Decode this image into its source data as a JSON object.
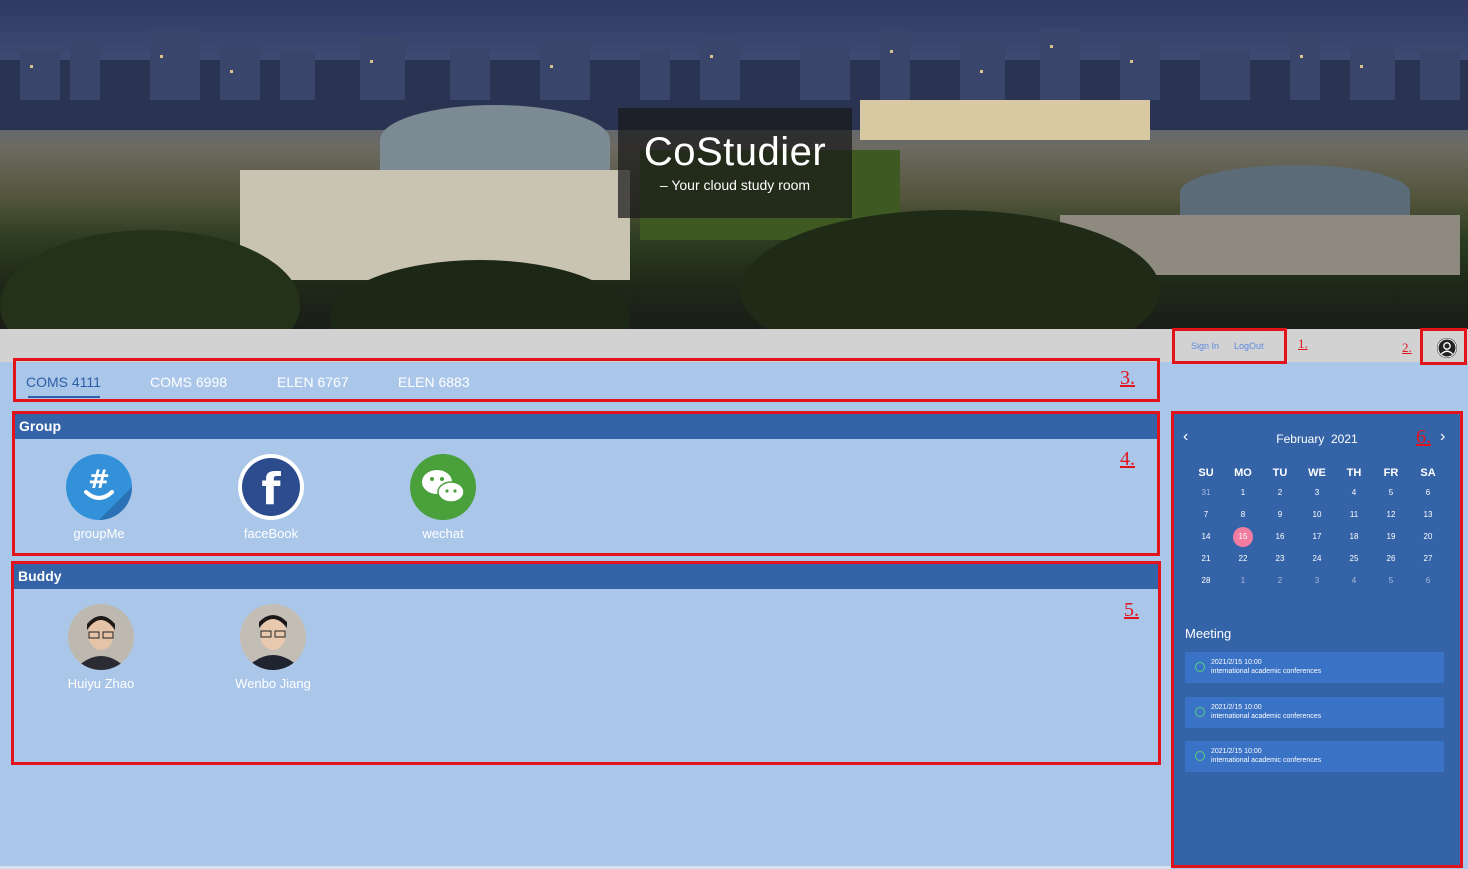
{
  "hero": {
    "title": "CoStudier",
    "subtitle": "– Your cloud study room"
  },
  "auth": {
    "sign_in": "Sign In",
    "logout": "LogOut"
  },
  "markers": {
    "m1": "1.",
    "m2": "2.",
    "m3": "3.",
    "m4": "4.",
    "m5": "5.",
    "m6": "6."
  },
  "tabs": [
    {
      "label": "COMS 4111",
      "active": true
    },
    {
      "label": "COMS 6998",
      "active": false
    },
    {
      "label": "ELEN 6767",
      "active": false
    },
    {
      "label": "ELEN 6883",
      "active": false
    }
  ],
  "group": {
    "header": "Group",
    "items": [
      {
        "label": "groupMe",
        "icon": "groupme-icon"
      },
      {
        "label": "faceBook",
        "icon": "facebook-icon"
      },
      {
        "label": "wechat",
        "icon": "wechat-icon"
      }
    ]
  },
  "buddy": {
    "header": "Buddy",
    "items": [
      {
        "label": "Huiyu Zhao"
      },
      {
        "label": "Wenbo Jiang"
      }
    ]
  },
  "calendar": {
    "month": "February",
    "year": "2021",
    "weekdays": [
      "SU",
      "MO",
      "TU",
      "WE",
      "TH",
      "FR",
      "SA"
    ],
    "weeks": [
      [
        "31",
        "1",
        "2",
        "3",
        "4",
        "5",
        "6"
      ],
      [
        "7",
        "8",
        "9",
        "10",
        "11",
        "12",
        "13"
      ],
      [
        "14",
        "15",
        "16",
        "17",
        "18",
        "19",
        "20"
      ],
      [
        "21",
        "22",
        "23",
        "24",
        "25",
        "26",
        "27"
      ],
      [
        "28",
        "1",
        "2",
        "3",
        "4",
        "5",
        "6"
      ]
    ],
    "today": "15"
  },
  "meeting": {
    "title": "Meeting",
    "items": [
      {
        "time": "2021/2/15 10:00",
        "desc": "international academic conferences"
      },
      {
        "time": "2021/2/15 10:00",
        "desc": "international academic conferences"
      },
      {
        "time": "2021/2/15 10:00",
        "desc": "international academic conferences"
      }
    ]
  },
  "colors": {
    "accent": "#3463a8",
    "highlight": "#e3131c",
    "page_bg": "#aac6e9",
    "today": "#f27da0"
  }
}
